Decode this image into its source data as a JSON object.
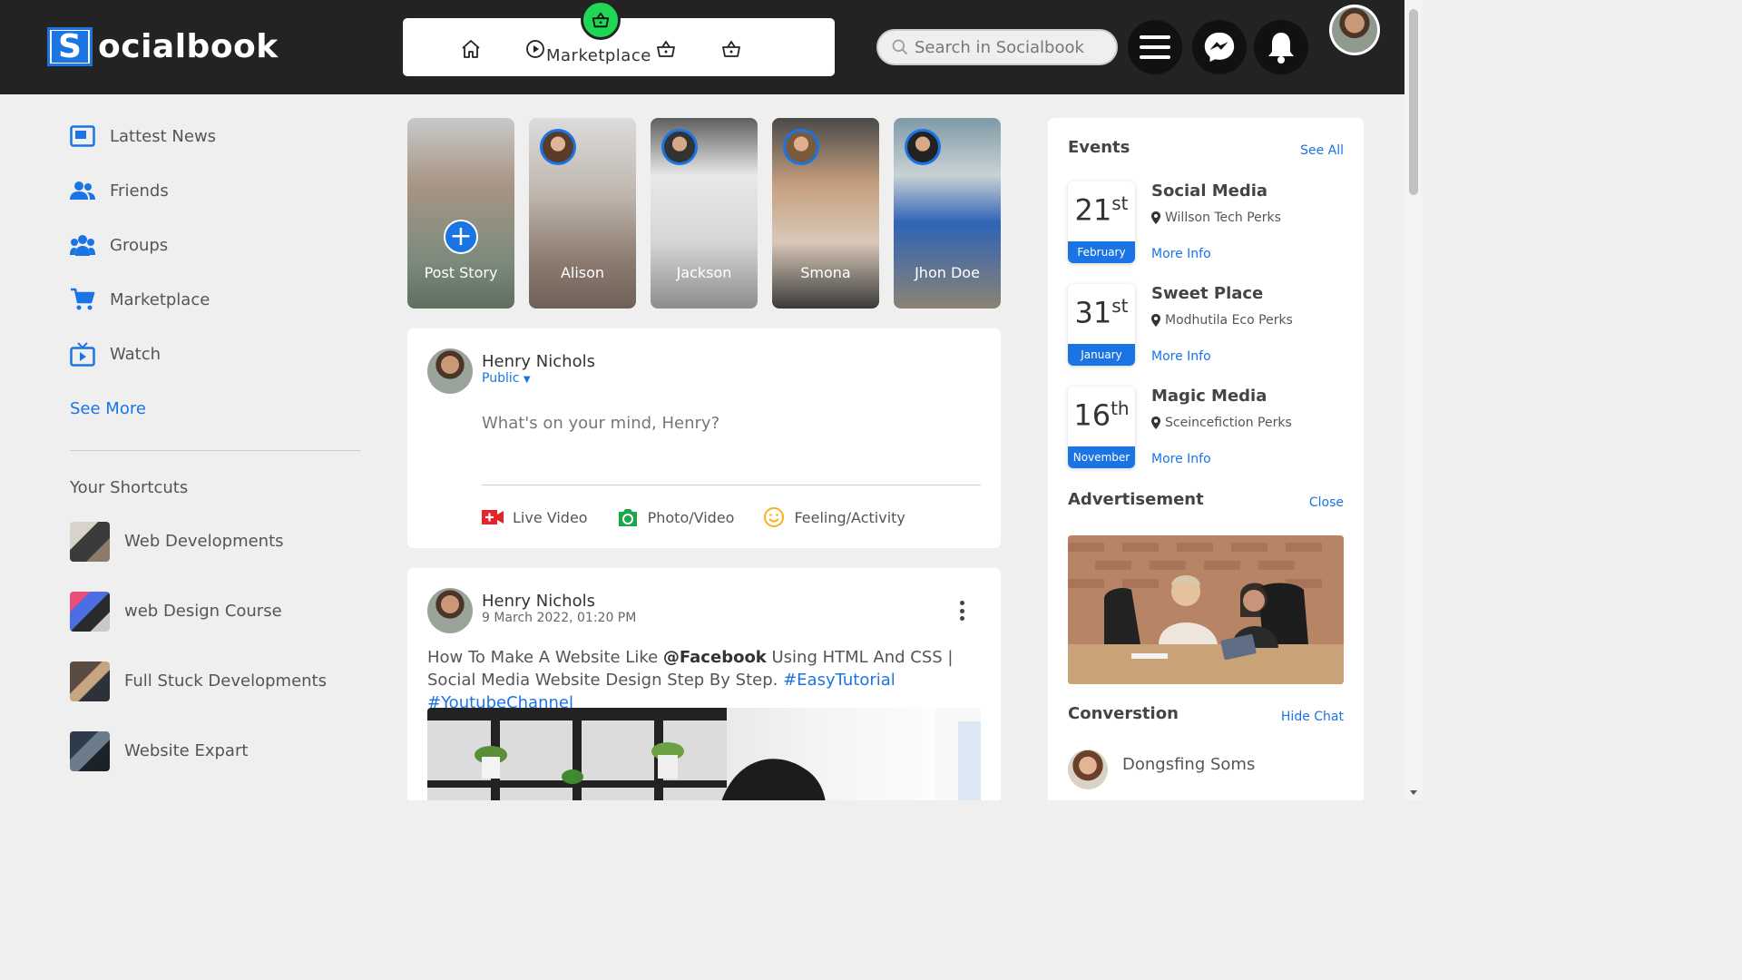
{
  "header": {
    "logo_letter": "S",
    "logo_text": "ocialbook",
    "nav_active_label": "Marketplace",
    "search_placeholder": "Search in Socialbook",
    "nav_icons": [
      "home-icon",
      "play-icon",
      "basket-icon",
      "basket-icon",
      "basket-icon"
    ],
    "action_icons": [
      "menu-icon",
      "messenger-icon",
      "bell-icon"
    ]
  },
  "sidebar": {
    "items": [
      {
        "label": "Lattest News",
        "icon": "news-icon"
      },
      {
        "label": "Friends",
        "icon": "friends-icon"
      },
      {
        "label": "Groups",
        "icon": "groups-icon"
      },
      {
        "label": "Marketplace",
        "icon": "cart-icon"
      },
      {
        "label": "Watch",
        "icon": "tv-icon"
      }
    ],
    "see_more": "See More",
    "shortcuts_title": "Your Shortcuts",
    "shortcuts": [
      {
        "label": "Web Developments"
      },
      {
        "label": "web Design Course"
      },
      {
        "label": "Full Stuck Developments"
      },
      {
        "label": "Website Expart"
      }
    ]
  },
  "stories": [
    {
      "name": "Post Story"
    },
    {
      "name": "Alison"
    },
    {
      "name": "Jackson"
    },
    {
      "name": "Smona"
    },
    {
      "name": "Jhon Doe"
    }
  ],
  "composer": {
    "user_name": "Henry Nichols",
    "privacy": "Public",
    "placeholder": "What's on your mind, Henry?",
    "actions": [
      {
        "label": "Live Video",
        "icon": "live-video-icon"
      },
      {
        "label": "Photo/Video",
        "icon": "camera-icon"
      },
      {
        "label": "Feeling/Activity",
        "icon": "smile-icon"
      }
    ]
  },
  "post": {
    "user_name": "Henry Nichols",
    "date": "9 March 2022, 01:20 PM",
    "text_before": "How To Make A Website Like ",
    "mention": "@Facebook",
    "text_after": " Using HTML And CSS | Social Media Website Design Step By Step. ",
    "tag1": "#EasyTutorial",
    "tag2": "#YoutubeChannel"
  },
  "right": {
    "events_title": "Events",
    "see_all": "See All",
    "events": [
      {
        "day": "21",
        "suffix": "st",
        "month": "February",
        "title": "Social Media",
        "location": "Willson Tech Perks",
        "more": "More Info"
      },
      {
        "day": "31",
        "suffix": "st",
        "month": "January",
        "title": "Sweet Place",
        "location": "Modhutila Eco Perks",
        "more": "More Info"
      },
      {
        "day": "16",
        "suffix": "th",
        "month": "November",
        "title": "Magic Media",
        "location": "Sceincefiction Perks",
        "more": "More Info"
      }
    ],
    "ad_title": "Advertisement",
    "ad_close": "Close",
    "chat_title": "Converstion",
    "hide_chat": "Hide Chat",
    "chat_user": "Dongsfing Soms"
  },
  "colors": {
    "accent": "#1b74e4",
    "topbar": "#232323",
    "active_nav": "#1fd655",
    "background": "#efefef"
  }
}
